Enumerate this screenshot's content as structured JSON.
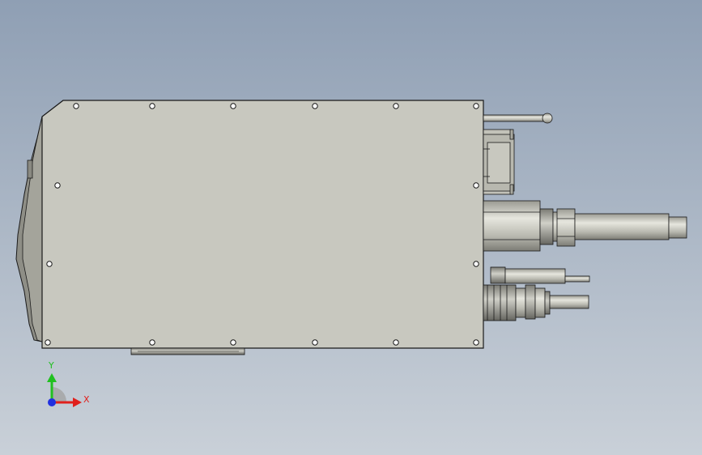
{
  "viewport": {
    "background_top": "#8f9fb4",
    "background_bottom": "#c9d0d8",
    "part_fill": "#c8c8bf",
    "part_stroke": "#1a1a1a",
    "hole_fill": "#ffffff"
  },
  "triad": {
    "x_label": "X",
    "y_label": "Y",
    "x_color": "#e0201c",
    "y_color": "#20c020",
    "z_color": "#2030e0"
  }
}
